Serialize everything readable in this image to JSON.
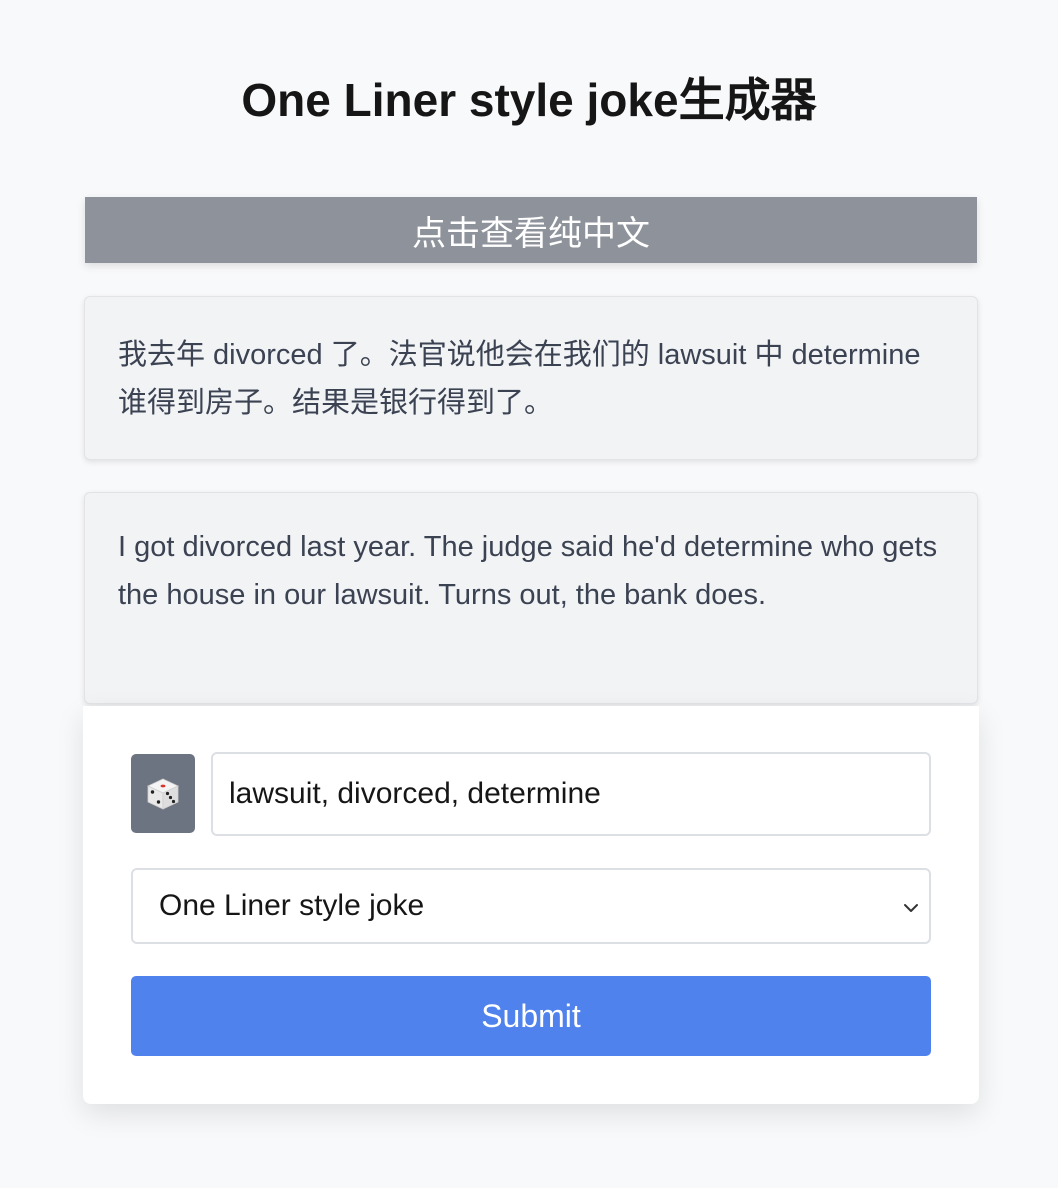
{
  "page": {
    "title": "One Liner style joke生成器"
  },
  "toggle": {
    "label": "点击查看纯中文"
  },
  "joke_cards": {
    "mixed_text": "我去年 divorced 了。法官说他会在我们的 lawsuit 中 determine 谁得到房子。结果是银行得到了。",
    "english_text": "I got divorced last year. The judge said he'd determine who gets the house in our lawsuit. Turns out, the bank does."
  },
  "form": {
    "dice_icon": "dice-icon",
    "keywords_value": "lawsuit, divorced, determine",
    "style_selected": "One Liner style joke",
    "submit_label": "Submit"
  },
  "colors": {
    "background": "#f8f9fb",
    "toggle_bar": "#8d929b",
    "card_background": "#f2f3f5",
    "dice_button": "#6c7381",
    "submit_button": "#4f82ec"
  }
}
